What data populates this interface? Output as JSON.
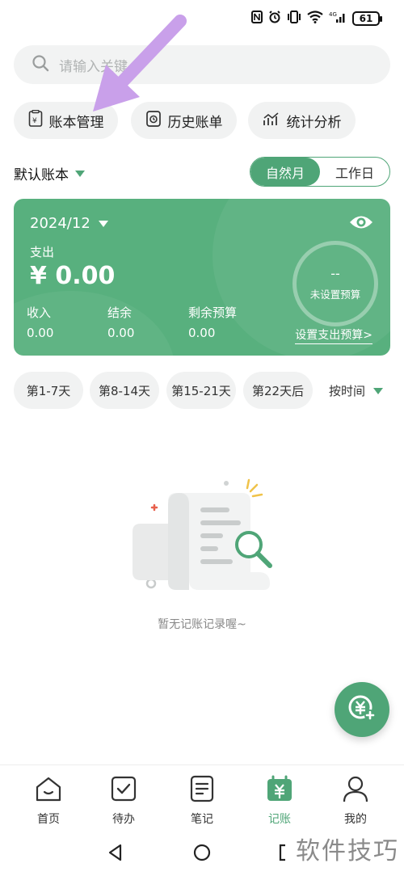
{
  "status": {
    "battery": "61"
  },
  "search": {
    "placeholder": "请输入关键"
  },
  "quick_actions": [
    {
      "label": "账本管理"
    },
    {
      "label": "历史账单"
    },
    {
      "label": "统计分析"
    }
  ],
  "book": {
    "name": "默认账本"
  },
  "period_toggle": {
    "natural_month": "自然月",
    "workday": "工作日"
  },
  "card": {
    "period": "2024/12",
    "expense_label": "支出",
    "expense_amount": "¥ 0.00",
    "income_label": "收入",
    "income_value": "0.00",
    "balance_label": "结余",
    "balance_value": "0.00",
    "remaining_label": "剩余预算",
    "remaining_value": "0.00",
    "budget_dash": "--",
    "budget_status": "未设置预算",
    "budget_link": "设置支出预算>"
  },
  "filters": {
    "chips": [
      "第1-7天",
      "第8-14天",
      "第15-21天",
      "第22天后"
    ],
    "sort": "按时间"
  },
  "empty": {
    "text": "暂无记账记录喔~"
  },
  "tabs": [
    {
      "label": "首页"
    },
    {
      "label": "待办"
    },
    {
      "label": "笔记"
    },
    {
      "label": "记账"
    },
    {
      "label": "我的"
    }
  ],
  "watermark": "软件技巧",
  "colors": {
    "accent": "#4fa577",
    "card": "#58b07e",
    "arrow": "#c9a0ea"
  }
}
